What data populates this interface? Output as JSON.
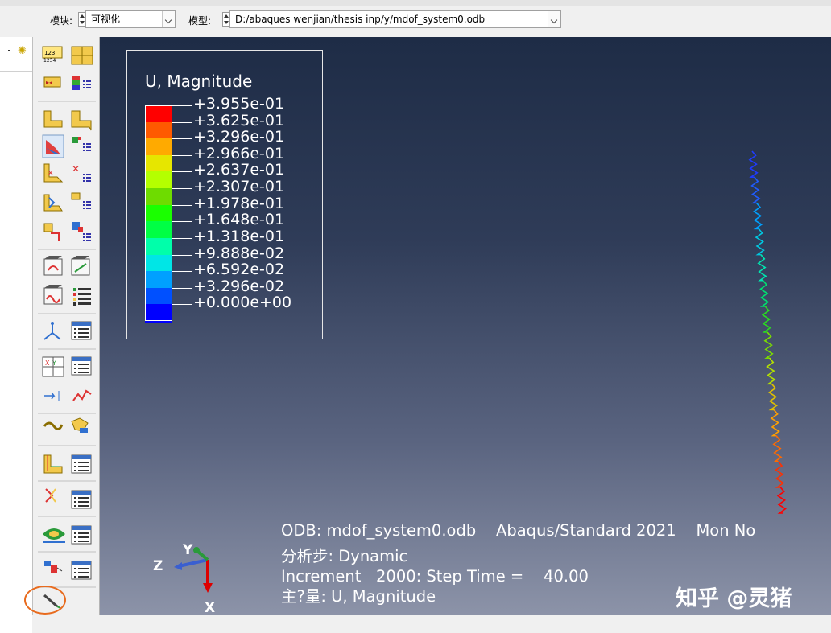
{
  "toolbar": {
    "module_label": "模块:",
    "module_value": "可视化",
    "model_label": "模型:",
    "model_value": "D:/abaques wenjian/thesis inp/y/mdof_system0.odb"
  },
  "legend": {
    "title": "U, Magnitude",
    "entries": [
      "+3.955e-01",
      "+3.625e-01",
      "+3.296e-01",
      "+2.966e-01",
      "+2.637e-01",
      "+2.307e-01",
      "+1.978e-01",
      "+1.648e-01",
      "+1.318e-01",
      "+9.888e-02",
      "+6.592e-02",
      "+3.296e-02",
      "+0.000e+00"
    ],
    "colors": [
      "#ff0000",
      "#ff5a00",
      "#ffaa00",
      "#e6e600",
      "#b4ff00",
      "#6edc00",
      "#1aff00",
      "#00ff44",
      "#00ffaa",
      "#00e6e6",
      "#00a0ff",
      "#0050ff",
      "#0000ff"
    ]
  },
  "info": {
    "line1": "ODB: mdof_system0.odb    Abaqus/Standard 2021    Mon No",
    "line2": "分析步: Dynamic",
    "line3": "Increment   2000: Step Time =    40.00",
    "line4": "主?量: U, Magnitude"
  },
  "triad": {
    "x": "X",
    "y": "Y",
    "z": "Z"
  },
  "watermark": "知乎 @灵猪",
  "tools": [
    "legend-state-icon",
    "color-code-icon",
    "plot-undeformed-icon",
    "plot-deformed-icon",
    "plot-contours-icon",
    "contour-options-icon",
    "plot-symbols-icon",
    "symbol-options-icon",
    "plot-material-orientation-icon",
    "orientation-options-icon",
    "animate-scale-factor-icon",
    "animate-time-history-icon",
    "animate-harmonic-icon",
    "animation-options-icon",
    "coordinate-system-icon",
    "csys-manager-icon",
    "xy-data-icon",
    "xy-data-manager-icon",
    "path-icon",
    "xy-plot-icon",
    "view-cut-icon",
    "view-cut-manager-icon",
    "free-body-cut-icon",
    "free-body-manager-icon",
    "stream-icon",
    "stream-manager-icon",
    "display-group-icon",
    "display-group-manager-icon",
    "active-view-cut-icon",
    "view-cut-toggle-icon",
    "query-icon"
  ]
}
